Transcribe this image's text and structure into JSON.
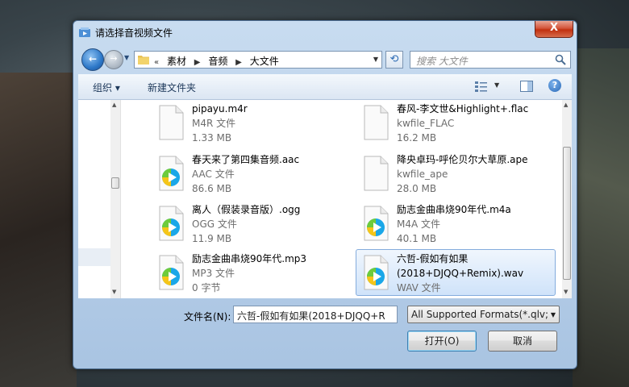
{
  "window": {
    "title": "请选择音视频文件",
    "close_label": "X"
  },
  "address": {
    "crumbs": [
      "«",
      "素材",
      "音频",
      "大文件"
    ],
    "search_placeholder": "搜索 大文件"
  },
  "toolbar": {
    "organize": "组织 ▾",
    "new_folder": "新建文件夹",
    "help": "?"
  },
  "files": [
    {
      "name": "pipayu.m4r",
      "type": "M4R 文件",
      "size": "1.33 MB",
      "icon": "blank-file-icon"
    },
    {
      "name": "春风-李文世&Highlight+.flac",
      "type": "kwfile_FLAC",
      "size": "16.2 MB",
      "icon": "blank-file-icon"
    },
    {
      "name": "春天来了第四集音频.aac",
      "type": "AAC 文件",
      "size": "86.6 MB",
      "icon": "media-play-icon"
    },
    {
      "name": "降央卓玛-呼伦贝尔大草原.ape",
      "type": "kwfile_ape",
      "size": "28.0 MB",
      "icon": "blank-file-icon"
    },
    {
      "name": "离人（假装录音版）.ogg",
      "type": "OGG 文件",
      "size": "11.9 MB",
      "icon": "media-play-icon"
    },
    {
      "name": "励志金曲串烧90年代.m4a",
      "type": "M4A 文件",
      "size": "40.1 MB",
      "icon": "media-play-icon"
    },
    {
      "name": "励志金曲串烧90年代.mp3",
      "type": "MP3 文件",
      "size": "0 字节",
      "icon": "media-play-icon"
    },
    {
      "name": "六哲-假如有如果",
      "name2": "(2018+DJQQ+Remix).wav",
      "type": "WAV 文件",
      "size": "",
      "icon": "media-play-icon",
      "selected": true
    }
  ],
  "bottom": {
    "filename_label": "文件名(N):",
    "filename_value": "六哲-假如有如果(2018+DJQQ+R",
    "filter_value": "All Supported Formats(*.qlv;",
    "open_label": "打开(O)",
    "cancel_label": "取消"
  },
  "colors": {
    "accent": "#2d78c8",
    "play_blue": "#1aa7e8",
    "play_green": "#6ecb3c",
    "play_yellow": "#f5c518",
    "selection": "#cfe3fa"
  }
}
